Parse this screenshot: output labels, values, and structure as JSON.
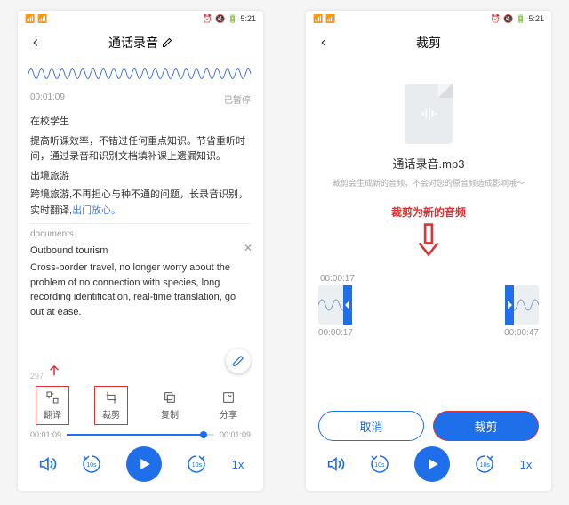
{
  "status": {
    "time": "5:21"
  },
  "left": {
    "title": "通话录音",
    "time": "00:01:09",
    "state": "已暂停",
    "cn1": "在校学生",
    "cn2": "提高听课效率，不错过任何重点知识。节省重听时间，通过录音和识别文档填补课上遗漏知识。",
    "cn3": "出境旅游",
    "cn4a": "跨境旅游,不再担心与种不通的问题，长录音识别，实时翻译,",
    "cn4b": "出门放心。",
    "hint": "documents.",
    "en_title": "Outbound tourism",
    "en_text": "Cross-border travel, no longer worry about the problem of no connection with species, long recording identification, real-time translation, go out at ease.",
    "tiny": "297",
    "actions": {
      "translate": "翻译",
      "crop": "裁剪",
      "copy": "复制",
      "share": "分享"
    },
    "t_start": "00:01:09",
    "t_end": "00:01:09",
    "speed": "1x"
  },
  "right": {
    "title": "裁剪",
    "filename": "通话录音.mp3",
    "note": "裁剪会生成新的音频，不会对您的原音频造成影响哦～",
    "red": "裁剪为新的音频",
    "sel_time": "00:00:17",
    "start": "00:00:17",
    "end": "00:00:47",
    "cancel": "取消",
    "confirm": "裁剪",
    "speed": "1x"
  }
}
